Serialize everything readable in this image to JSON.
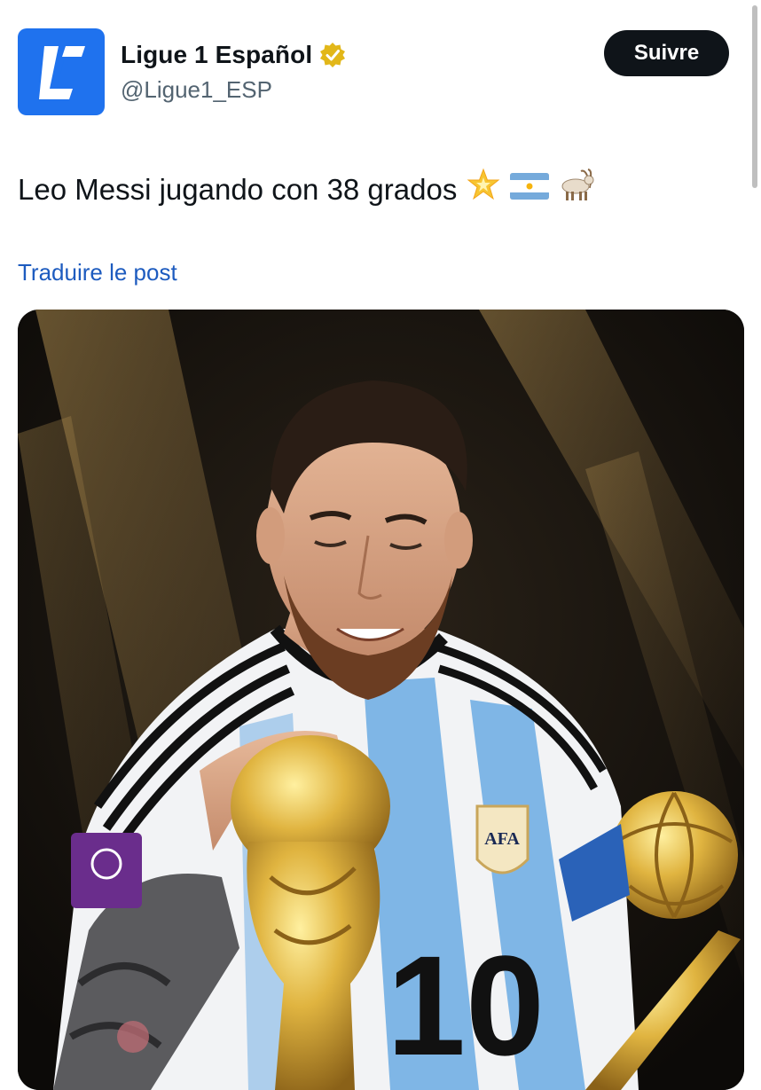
{
  "account": {
    "display_name": "Ligue 1 Español",
    "handle": "@Ligue1_ESP",
    "verified": true,
    "avatar_icon": "ligue1-logo-icon",
    "avatar_color": "#1f72ee",
    "avatar_glyph": "L"
  },
  "follow_button": {
    "label": "Suivre"
  },
  "tweet": {
    "text": "Leo Messi jugando con 38 grados",
    "emojis": [
      "glowing-star-icon",
      "argentina-flag-icon",
      "goat-icon"
    ]
  },
  "translate_link": {
    "label": "Traduire le post",
    "color": "#1d5bbf"
  },
  "media": {
    "kind": "photo",
    "jersey_number": "10",
    "badge_text": "AFA",
    "palette": {
      "background": "#1a1512",
      "gold": "#d4a53a",
      "sky_blue": "#7fb6e6"
    }
  }
}
